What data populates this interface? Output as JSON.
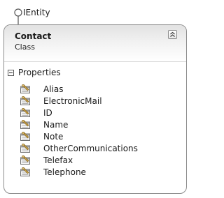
{
  "interface": {
    "name": "IEntity",
    "icon": "interface-lollipop-icon"
  },
  "class_shape": {
    "name": "Contact",
    "kind": "Class",
    "collapse_icon": "collapse-chevron-icon",
    "border_color": "#8c8c8c",
    "header_gradient": [
      "#e2e2e2",
      "#ffffff"
    ]
  },
  "properties": {
    "label": "Properties",
    "toggle_icon": "collapse-minus-icon",
    "item_icon": "property-wrench-icon",
    "items": [
      "Alias",
      "ElectronicMail",
      "ID",
      "Name",
      "Note",
      "OtherCommunications",
      "Telefax",
      "Telephone"
    ]
  }
}
